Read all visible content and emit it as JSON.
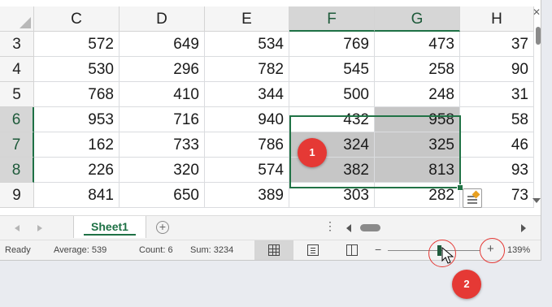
{
  "columns": [
    "C",
    "D",
    "E",
    "F",
    "G",
    "H"
  ],
  "rows": [
    {
      "num": "3",
      "cells": [
        "572",
        "649",
        "534",
        "769",
        "473",
        "37"
      ]
    },
    {
      "num": "4",
      "cells": [
        "530",
        "296",
        "782",
        "545",
        "258",
        "90"
      ]
    },
    {
      "num": "5",
      "cells": [
        "768",
        "410",
        "344",
        "500",
        "248",
        "31"
      ]
    },
    {
      "num": "6",
      "cells": [
        "953",
        "716",
        "940",
        "432",
        "958",
        "58"
      ]
    },
    {
      "num": "7",
      "cells": [
        "162",
        "733",
        "786",
        "324",
        "325",
        "46"
      ]
    },
    {
      "num": "8",
      "cells": [
        "226",
        "320",
        "574",
        "382",
        "813",
        "93"
      ]
    },
    {
      "num": "9",
      "cells": [
        "841",
        "650",
        "389",
        "303",
        "282",
        "73"
      ]
    }
  ],
  "sheet_tab": {
    "label": "Sheet1"
  },
  "status": {
    "ready": "Ready",
    "average": "Average: 539",
    "count": "Count: 6",
    "sum": "Sum: 3234"
  },
  "zoom": {
    "minus": "−",
    "plus": "+",
    "value": "139%"
  },
  "markers": {
    "one": "1",
    "two": "2"
  },
  "colors": {
    "accent": "#1e7145",
    "selection": "#c6c6c6",
    "marker": "#e53935"
  }
}
